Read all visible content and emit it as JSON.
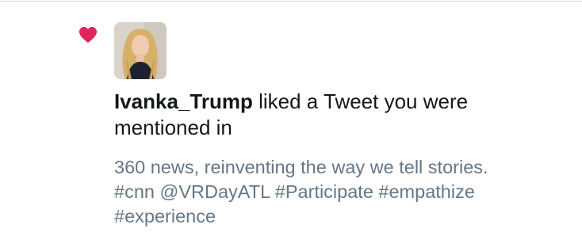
{
  "notification": {
    "icon": "heart-icon",
    "icon_color": "#e0245e",
    "avatar": "user-avatar",
    "username": "Ivanka_Trump",
    "action_text": " liked a Tweet you were mentioned in",
    "tweet_text": "360 news, reinventing the way we tell stories.\n#cnn @VRDayATL #Participate #empathize\n#experience"
  }
}
